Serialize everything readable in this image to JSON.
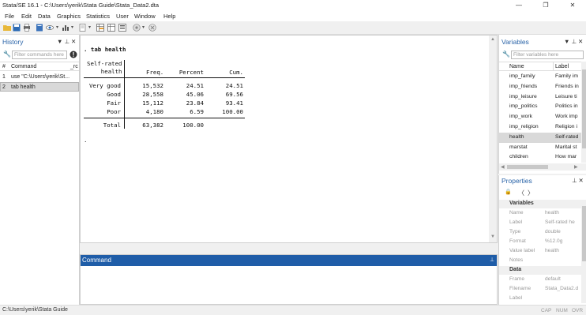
{
  "window": {
    "title": "Stata/SE 16.1 - C:\\Users\\yerik\\Stata Guide\\Stata_Data2.dta",
    "minimize": "—",
    "maximize": "❐",
    "close": "✕"
  },
  "menu": [
    "File",
    "Edit",
    "Data",
    "Graphics",
    "Statistics",
    "User",
    "Window",
    "Help"
  ],
  "history": {
    "title": "History",
    "filter_placeholder": "Filter commands here",
    "col_num": "#",
    "col_command": "Command",
    "col_rc": "_rc",
    "rows": [
      {
        "num": "1",
        "command": "use \"C:\\Users\\yerik\\St..."
      },
      {
        "num": "2",
        "command": "tab health"
      }
    ]
  },
  "results": {
    "command_echo": ". tab health",
    "header_line1": "Self-rated",
    "header_line2": "    health",
    "col_freq": "Freq.",
    "col_percent": "Percent",
    "col_cum": "Cum.",
    "rows": [
      {
        "label": "Very good",
        "freq": "15,532",
        "percent": "24.51",
        "cum": "24.51"
      },
      {
        "label": "Good",
        "freq": "28,558",
        "percent": "45.06",
        "cum": "69.56"
      },
      {
        "label": "Fair",
        "freq": "15,112",
        "percent": "23.84",
        "cum": "93.41"
      },
      {
        "label": "Poor",
        "freq": "4,180",
        "percent": "6.59",
        "cum": "100.00"
      }
    ],
    "total_label": "Total",
    "total_freq": "63,382",
    "total_percent": "100.00",
    "prompt": "."
  },
  "command": {
    "title": "Command"
  },
  "variables": {
    "title": "Variables",
    "filter_placeholder": "Filter variables here",
    "col_name": "Name",
    "col_label": "Label",
    "rows": [
      {
        "name": "imp_family",
        "label": "Family im"
      },
      {
        "name": "imp_friends",
        "label": "Friends in"
      },
      {
        "name": "imp_leisure",
        "label": "Leisure ti"
      },
      {
        "name": "imp_politics",
        "label": "Politics in"
      },
      {
        "name": "imp_work",
        "label": "Work imp"
      },
      {
        "name": "imp_religion",
        "label": "Religion i"
      },
      {
        "name": "health",
        "label": "Self-rated"
      },
      {
        "name": "marstat",
        "label": "Marital st"
      },
      {
        "name": "children",
        "label": "How mar"
      }
    ],
    "selected_index": 6
  },
  "properties": {
    "title": "Properties",
    "section_variables": "Variables",
    "variables_fields": [
      {
        "key": "Name",
        "value": "health"
      },
      {
        "key": "Label",
        "value": "Self-rated he"
      },
      {
        "key": "Type",
        "value": "double"
      },
      {
        "key": "Format",
        "value": "%12.0g"
      },
      {
        "key": "Value label",
        "value": "health"
      },
      {
        "key": "Notes",
        "value": ""
      }
    ],
    "section_data": "Data",
    "data_fields": [
      {
        "key": "Frame",
        "value": "default"
      },
      {
        "key": "Filename",
        "value": "Stata_Data2.d"
      },
      {
        "key": "Label",
        "value": ""
      }
    ]
  },
  "statusbar": {
    "path": "C:\\Users\\yerik\\Stata Guide",
    "caps": "CAP",
    "num": "NUM",
    "ovr": "OVR"
  },
  "colors": {
    "accent": "#1f5da8",
    "panel_title": "#2a64a8",
    "selected_row": "#d9d9d9"
  }
}
